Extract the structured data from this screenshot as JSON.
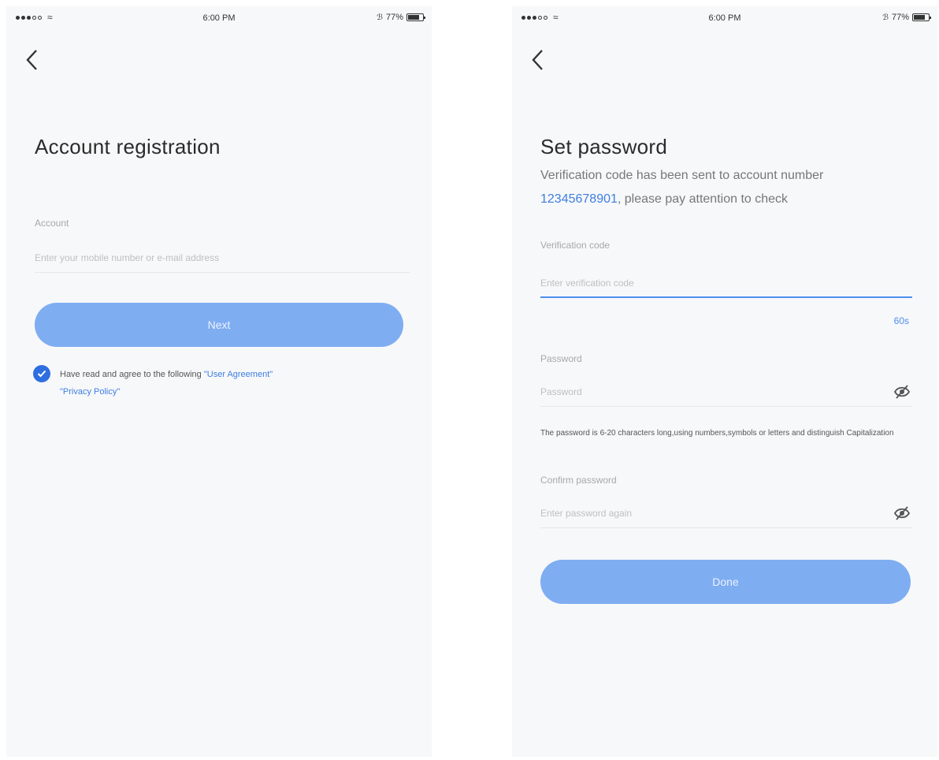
{
  "status_bar": {
    "time": "6:00 PM",
    "battery": "77%",
    "battery_level": 0.77
  },
  "left_screen": {
    "title": "Account registration",
    "account_field": {
      "label": "Account",
      "placeholder": "Enter your mobile number or e-mail address"
    },
    "submit_label": "Next",
    "agreement": {
      "prefix": "Have read and agree to the following",
      "user_agreement": "\"User Agreement\"",
      "privacy_policy": "\"Privacy Policy\""
    }
  },
  "right_screen": {
    "title": "Set password",
    "subtitle_prefix": "Verification code has been sent to account number",
    "account_number": "12345678901",
    "subtitle_suffix": ", please pay attention to check",
    "code_field": {
      "label": "Verification code",
      "placeholder": "Enter verification code"
    },
    "resend_label": "60s",
    "password_field": {
      "label": "Password",
      "placeholder": "Password"
    },
    "password_hint": "The password is 6-20 characters long,using numbers,symbols or letters and distinguish Capitalization",
    "confirm_field": {
      "label": "Confirm password",
      "placeholder": "Enter password again"
    },
    "submit_label": "Done"
  },
  "colors": {
    "accent": "#3d7ee0",
    "button": "#7fadf2",
    "background": "#f7f8fa"
  },
  "icons": [
    "back-arrow-icon",
    "eye-off-icon",
    "check-icon",
    "wifi-icon",
    "battery-icon",
    "bluetooth-icon"
  ]
}
